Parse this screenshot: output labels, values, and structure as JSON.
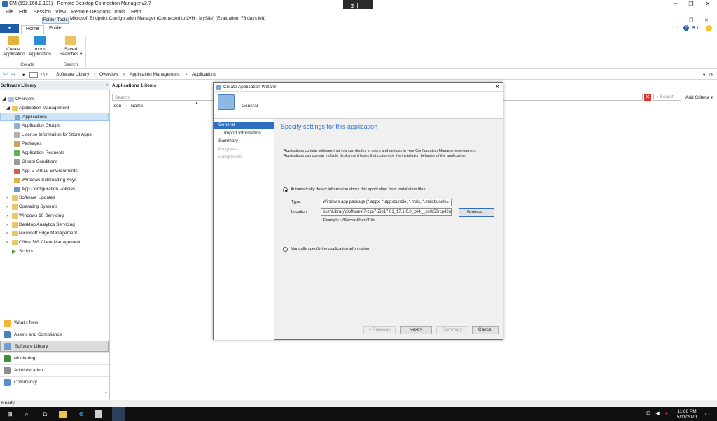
{
  "rdc": {
    "title": "CM (192.168.2.101) - Remote Desktop Connection Manager v2.7",
    "menu": [
      "File",
      "Edit",
      "Session",
      "View",
      "Remote Desktops",
      "Tools",
      "Help"
    ],
    "zoom": "⊕ | ···"
  },
  "cm": {
    "title": "Microsoft Endpoint Configuration Manager (Connected to LVH - MySite) (Evaluation, 76 days left)",
    "file_tab": "▾",
    "folder_tools": "Folder Tools",
    "tabs": [
      "Home",
      "Folder"
    ],
    "ribbon": {
      "create_application": "Create Application",
      "import_application": "Import Application",
      "saved_searches": "Saved Searches ▾",
      "group_create": "Create",
      "group_search": "Search"
    },
    "breadcrumb": [
      "Software Library",
      "Overview",
      "Application Management",
      "Applications"
    ]
  },
  "nav": {
    "header": "Software Library",
    "overview": "Overview",
    "app_mgmt": "Application Management",
    "items": [
      "Applications",
      "Application Groups",
      "License Information for Store Apps",
      "Packages",
      "Application Requests",
      "Global Conditions",
      "App-V Virtual Environments",
      "Windows Sideloading Keys",
      "App Configuration Policies"
    ],
    "folders": [
      "Software Updates",
      "Operating Systems",
      "Windows 10 Servicing",
      "Desktop Analytics Servicing",
      "Microsoft Edge Management",
      "Office 365 Client Management"
    ],
    "scripts": "Scripts",
    "workspaces": [
      "What's New",
      "Assets and Compliance",
      "Software Library",
      "Monitoring",
      "Administration",
      "Community"
    ]
  },
  "content": {
    "header": "Applications 1 items",
    "search_placeholder": "Search",
    "search_btn": "Search",
    "add_criteria": "Add Criteria ▾",
    "columns": [
      "Icon",
      "Name"
    ]
  },
  "wizard": {
    "title": "Create Application Wizard",
    "page": "General",
    "steps": [
      "General",
      "Import Information",
      "Summary",
      "Progress",
      "Completion"
    ],
    "heading": "Specify settings for this application",
    "description": "Applications contain software that you can deploy to users and devices in your Configuration Manager environment. Applications can contain multiple deployment types that customize the installation behavior of the application.",
    "auto_label": "Automatically detect information about this application from installation files:",
    "type_label": "Type:",
    "type_value": "Windows app package (*.appx, *.appxbundle, *.msix, *.msixbundle)",
    "location_label": "Location:",
    "location_value": "\\\\cm\\Library\\Software\\7-zip\\7-Zip17.01_17.1.0.0_x64__xn9r50rcp42m",
    "browse": "Browse...",
    "example": "Example : \\\\Server\\Share\\File",
    "manual_label": "Manually specify the application information",
    "buttons": {
      "previous": "< Previous",
      "next": "Next >",
      "summary": "Summary",
      "cancel": "Cancel"
    }
  },
  "status": "Ready",
  "clock": {
    "time": "11:06 PM",
    "date": "5/11/2020"
  }
}
